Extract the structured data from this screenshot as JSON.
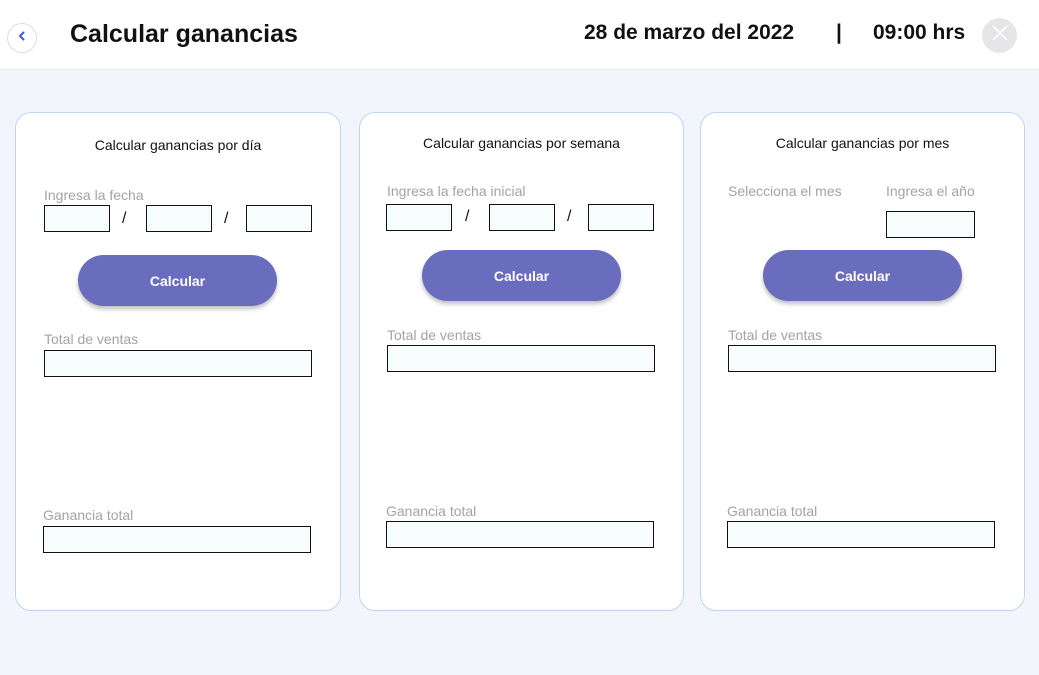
{
  "header": {
    "title": "Calcular ganancias",
    "date": "28 de marzo del 2022",
    "separator": "|",
    "time": "09:00 hrs",
    "back_icon": "chevron-left-icon",
    "close_icon": "close-icon"
  },
  "colors": {
    "accent": "#6a6cbd",
    "card_border": "#bcd6f5",
    "background": "#f3f5fc",
    "field_fill": "#f7fcfc"
  },
  "day_card": {
    "title": "Calcular ganancias por día",
    "date_label": "Ingresa la fecha",
    "separator": "/",
    "button": "Calcular",
    "sales_label": "Total de ventas",
    "profit_label": "Ganancia total"
  },
  "week_card": {
    "title": "Calcular ganancias por semana",
    "date_label": "Ingresa la fecha inicial",
    "separator": "/",
    "button": "Calcular",
    "sales_label": "Total de ventas",
    "profit_label": "Ganancia total"
  },
  "month_card": {
    "title": "Calcular ganancias por mes",
    "month_label": "Selecciona el mes",
    "year_label": "Ingresa el año",
    "button": "Calcular",
    "sales_label": "Total de ventas",
    "profit_label": "Ganancia total"
  }
}
